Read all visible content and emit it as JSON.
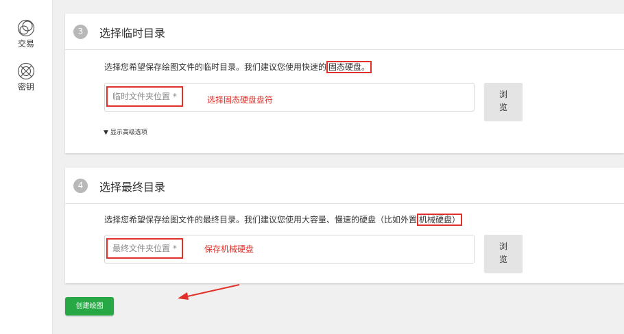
{
  "nav": {
    "items": [
      {
        "label": "交易",
        "icon": "exchange-icon"
      },
      {
        "label": "密钥",
        "icon": "key-icon"
      }
    ]
  },
  "temp_section": {
    "step": "3",
    "title": "选择临时目录",
    "desc_prefix": "选择您希望保存绘图文件的临时目录。我们建议您使用快速的",
    "desc_highlight": "固态硬盘。",
    "placeholder": "临时文件夹位置 *",
    "annotation": "选择固态硬盘盘符",
    "browse_label_1": "浏",
    "browse_label_2": "览",
    "advanced_label": "显示高级选项"
  },
  "final_section": {
    "step": "4",
    "title": "选择最终目录",
    "desc_prefix": "选择您希望保存绘图文件的最终目录。我们建议您使用大容量、慢速的硬盘（比如外置",
    "desc_highlight": "机械硬盘）",
    "placeholder": "最终文件夹位置 *",
    "annotation": "保存机械硬盘",
    "browse_label_1": "浏",
    "browse_label_2": "览"
  },
  "actions": {
    "create_label": "创建绘图"
  },
  "colors": {
    "accent_green": "#28a745",
    "annotation_red": "#e0302a"
  }
}
